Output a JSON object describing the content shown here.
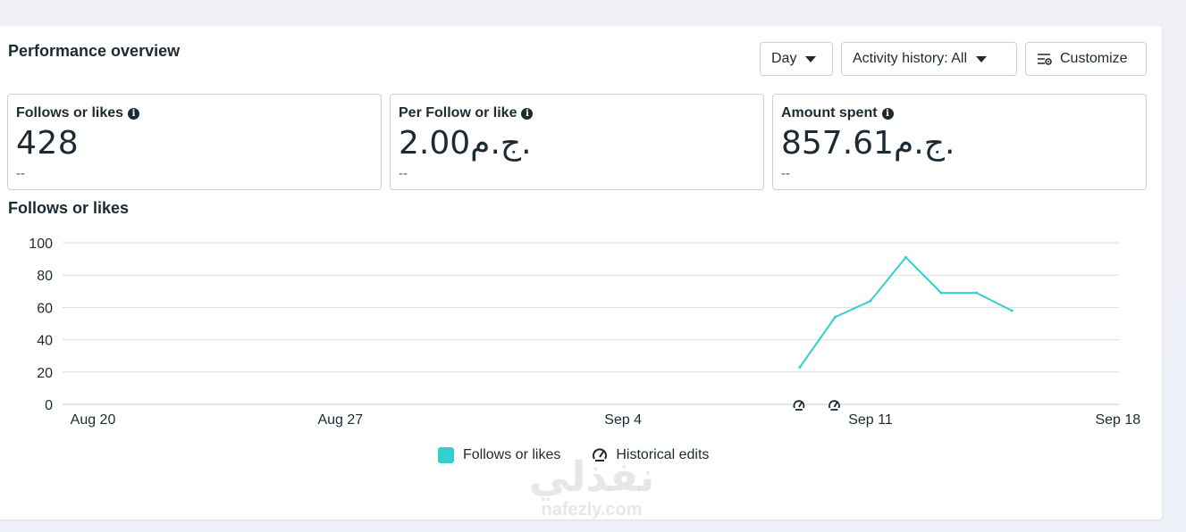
{
  "header": {
    "title": "Performance overview",
    "day_label": "Day",
    "activity_label": "Activity history: All",
    "customize_label": "Customize"
  },
  "metrics": [
    {
      "label": "Follows or likes",
      "value": "428",
      "sub": "--"
    },
    {
      "label": "Per Follow or like",
      "value": "2.00ج.م.",
      "sub": "--"
    },
    {
      "label": "Amount spent",
      "value": "857.61ج.م.",
      "sub": "--"
    }
  ],
  "chart_title": "Follows or likes",
  "chart_data": {
    "type": "line",
    "title": "Follows or likes",
    "x_ticks": [
      "Aug 20",
      "Aug 27",
      "Sep 4",
      "Sep 11",
      "Sep 18"
    ],
    "x_tick_days": [
      0,
      7,
      15,
      22,
      29
    ],
    "y_ticks": [
      0,
      20,
      40,
      60,
      80,
      100
    ],
    "ylim": [
      0,
      100
    ],
    "grid": true,
    "series": [
      {
        "name": "Follows or likes",
        "color": "#32cfcf",
        "x_days": [
          20,
          21,
          22,
          23,
          24,
          25,
          26
        ],
        "values": [
          23,
          54,
          64,
          91,
          69,
          69,
          58
        ]
      }
    ],
    "historical_edit_days": [
      20,
      21
    ]
  },
  "legend": {
    "series_label": "Follows or likes",
    "historical_label": "Historical edits"
  },
  "watermark": {
    "main": "نفذلي",
    "sub": "nafezly.com"
  },
  "icons": {
    "info": "info-icon",
    "customize": "sliders-icon",
    "caret": "caret-down-icon",
    "historical": "gauge-edit-icon"
  },
  "colors": {
    "accent": "#32cfcf",
    "text": "#1c2b33",
    "grid": "#dadde1"
  }
}
